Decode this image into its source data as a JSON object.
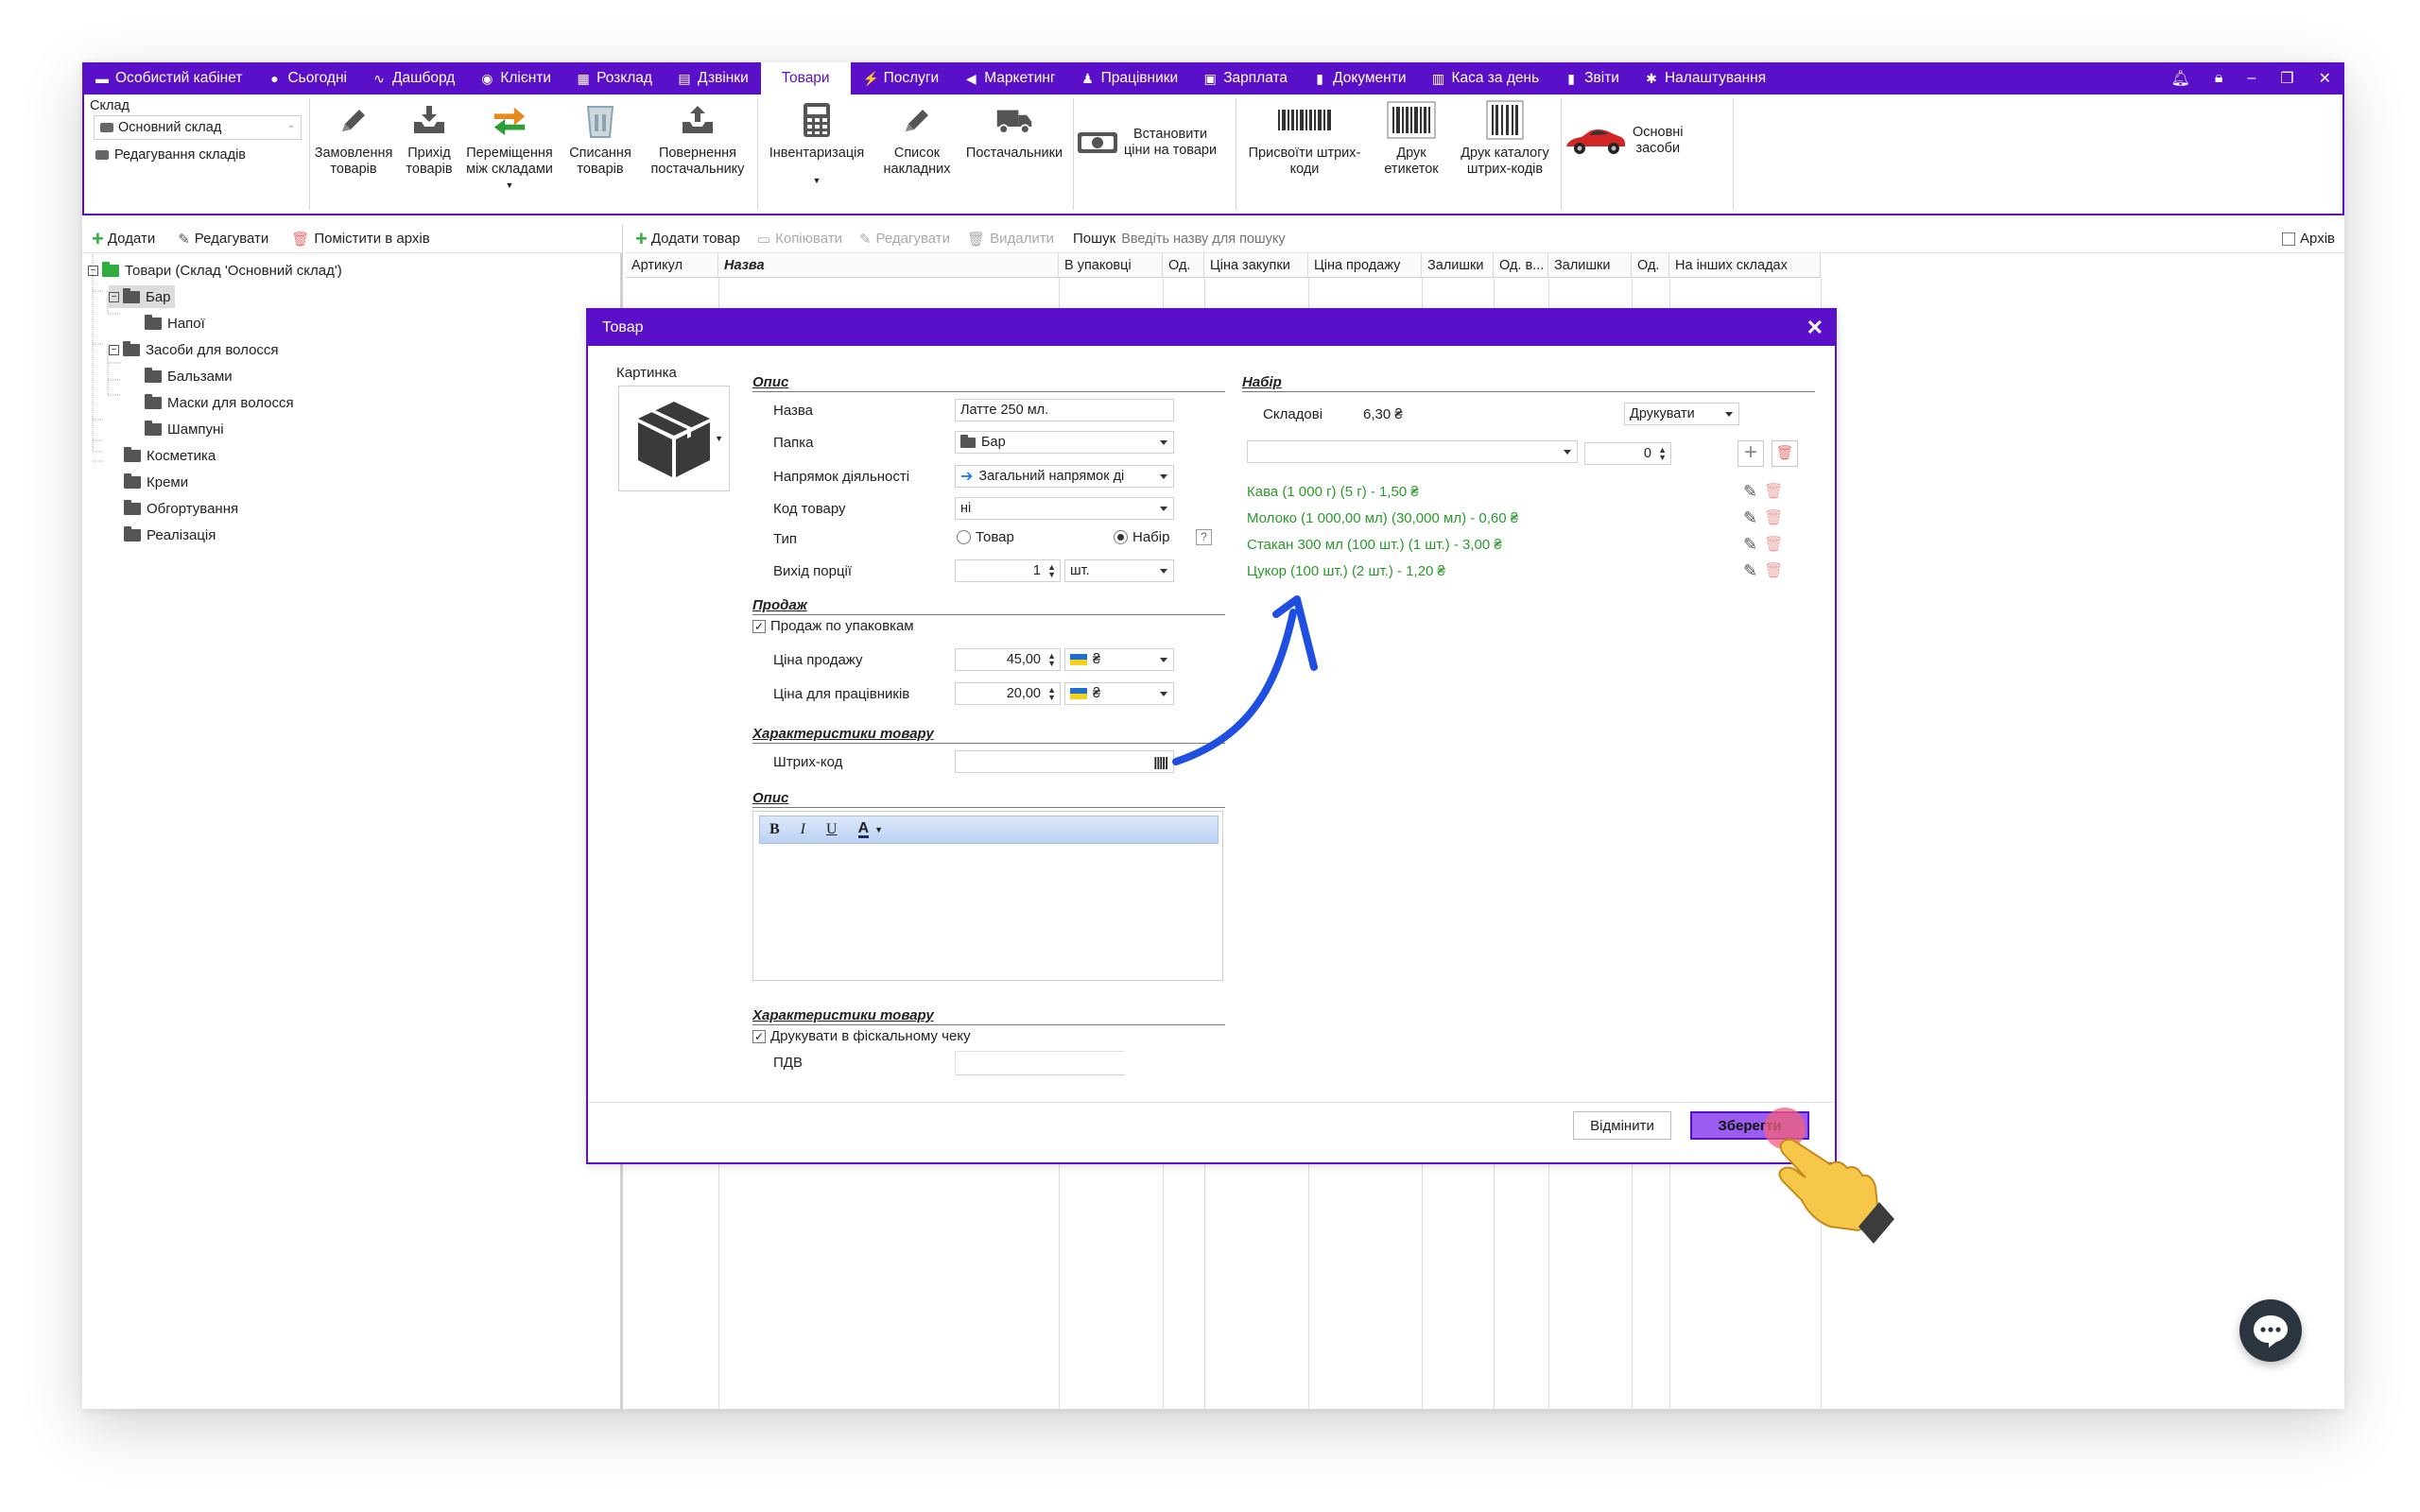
{
  "menu": {
    "items": [
      {
        "label": "Особистий кабінет",
        "icon": "wallet-icon"
      },
      {
        "label": "Сьогодні",
        "icon": "circle-icon"
      },
      {
        "label": "Дашборд",
        "icon": "pulse-icon"
      },
      {
        "label": "Клієнти",
        "icon": "user-circle-icon"
      },
      {
        "label": "Розклад",
        "icon": "calendar-icon"
      },
      {
        "label": "Дзвінки",
        "icon": "phone-book-icon"
      },
      {
        "label": "Товари",
        "icon": "",
        "active": true
      },
      {
        "label": "Послуги",
        "icon": "bolt-icon"
      },
      {
        "label": "Маркетинг",
        "icon": "megaphone-icon"
      },
      {
        "label": "Працівники",
        "icon": "person-icon"
      },
      {
        "label": "Зарплата",
        "icon": "cash-icon"
      },
      {
        "label": "Документи",
        "icon": "document-icon"
      },
      {
        "label": "Каса за день",
        "icon": "calculator-icon"
      },
      {
        "label": "Звіти",
        "icon": "bar-chart-icon"
      },
      {
        "label": "Налаштування",
        "icon": "gear-icon"
      }
    ]
  },
  "ribbon": {
    "sklad_label": "Склад",
    "sklad_value": "Основний склад",
    "sklad_edit": "Редагування складів",
    "buttons": {
      "order": "Замовлення\nтоварів",
      "income": "Прихід\nтоварів",
      "move": "Переміщення\nміж складами",
      "writeoff": "Списання\nтоварів",
      "return": "Повернення\nпостачальнику",
      "inventory": "Інвентаризація",
      "invoices": "Список\nнакладних",
      "suppliers": "Постачальники",
      "setprices": "Встановити\nціни на товари",
      "assignbarcodes": "Присвоїти штрих-\nкоди",
      "printlabels": "Друк\nетикеток",
      "printcatalog": "Друк каталогу\nштрих-кодів",
      "assets": "Основні\nзасоби"
    }
  },
  "left": {
    "toolbar": {
      "add": "Додати",
      "edit": "Редагувати",
      "archive": "Помістити в архів"
    },
    "tree": {
      "root": "Товари (Склад 'Основний склад')",
      "bar": "Бар",
      "drinks": "Напої",
      "hair": "Засоби для волосся",
      "balms": "Бальзами",
      "masks": "Маски для волосся",
      "shampoos": "Шампуні",
      "cosmetics": "Косметика",
      "creams": "Креми",
      "wraps": "Обгортування",
      "sales": "Реалізація"
    }
  },
  "right": {
    "toolbar": {
      "add": "Додати товар",
      "copy": "Копіювати",
      "edit": "Редагувати",
      "delete": "Видалити",
      "search_label": "Пошук",
      "search_placeholder": "Введіть назву для пошуку",
      "archive": "Архів"
    },
    "columns": [
      "Артикул",
      "Назва",
      "В упаковці",
      "Од.",
      "Ціна закупки",
      "Ціна продажу",
      "Залишки",
      "Од. в...",
      "Залишки",
      "Од.",
      "На інших складах"
    ]
  },
  "dialog": {
    "title": "Товар",
    "picture_label": "Картинка",
    "opys_title": "Опис",
    "name_label": "Назва",
    "name_value": "Латте 250 мл.",
    "folder_label": "Папка",
    "folder_value": "Бар",
    "direction_label": "Напрямок діяльності",
    "direction_value": "Загальний напрямок ді",
    "code_label": "Код товару",
    "code_value": "ні",
    "type_label": "Тип",
    "type_tovar": "Товар",
    "type_nabir": "Набір",
    "help": "?",
    "portion_label": "Вихід порції",
    "portion_value": "1",
    "portion_unit": "шт.",
    "prodazh_title": "Продаж",
    "by_pack": "Продаж по упаковкам",
    "price_label": "Ціна продажу",
    "price_value": "45,00",
    "currency": "₴",
    "staff_price_label": "Ціна для працівників",
    "staff_price_value": "20,00",
    "char_title": "Характеристики товару",
    "barcode_label": "Штрих-код",
    "desc_title": "Опис",
    "char_title2": "Характеристики товару",
    "fiscal": "Друкувати в фіскальному чеку",
    "vat_label": "ПДВ",
    "nabir_title": "Набір",
    "components_label": "Складові",
    "components_value": "6,30 ₴",
    "print_label": "Друкувати",
    "qty_value": "0",
    "components": [
      "Кава (1 000 г) (5 г) - 1,50 ₴",
      "Молоко (1 000,00 мл) (30,000 мл) - 0,60 ₴",
      "Стакан 300 мл (100 шт.) (1 шт.) - 3,00 ₴",
      "Цукор (100 шт.) (2 шт.) - 1,20 ₴"
    ],
    "cancel": "Відмінити",
    "save": "Зберегти"
  },
  "colors": {
    "accent": "#5a10c8",
    "green": "#2a9a2a",
    "highlight": "#9b5cf0"
  }
}
